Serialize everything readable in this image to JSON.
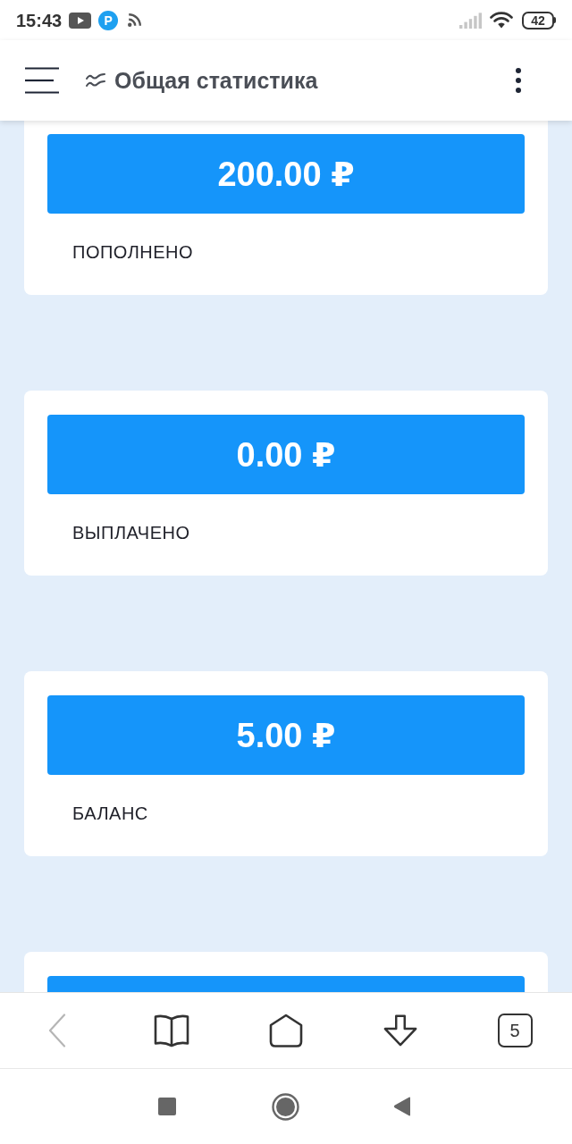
{
  "status_bar": {
    "time": "15:43",
    "notification_badge": "P",
    "battery": "42"
  },
  "app_bar": {
    "title": "Общая статистика"
  },
  "cards": [
    {
      "kind": "stat",
      "amount": "200.00 ₽",
      "label": "ПОПОЛНЕНО"
    },
    {
      "kind": "stat",
      "amount": "0.00 ₽",
      "label": "ВЫПЛАЧЕНО"
    },
    {
      "kind": "stat",
      "amount": "5.00 ₽",
      "label": "БАЛАНС"
    },
    {
      "kind": "cut_off"
    }
  ],
  "browser_toolbar": {
    "back": {
      "disabled": true
    },
    "tab_count": "5"
  }
}
